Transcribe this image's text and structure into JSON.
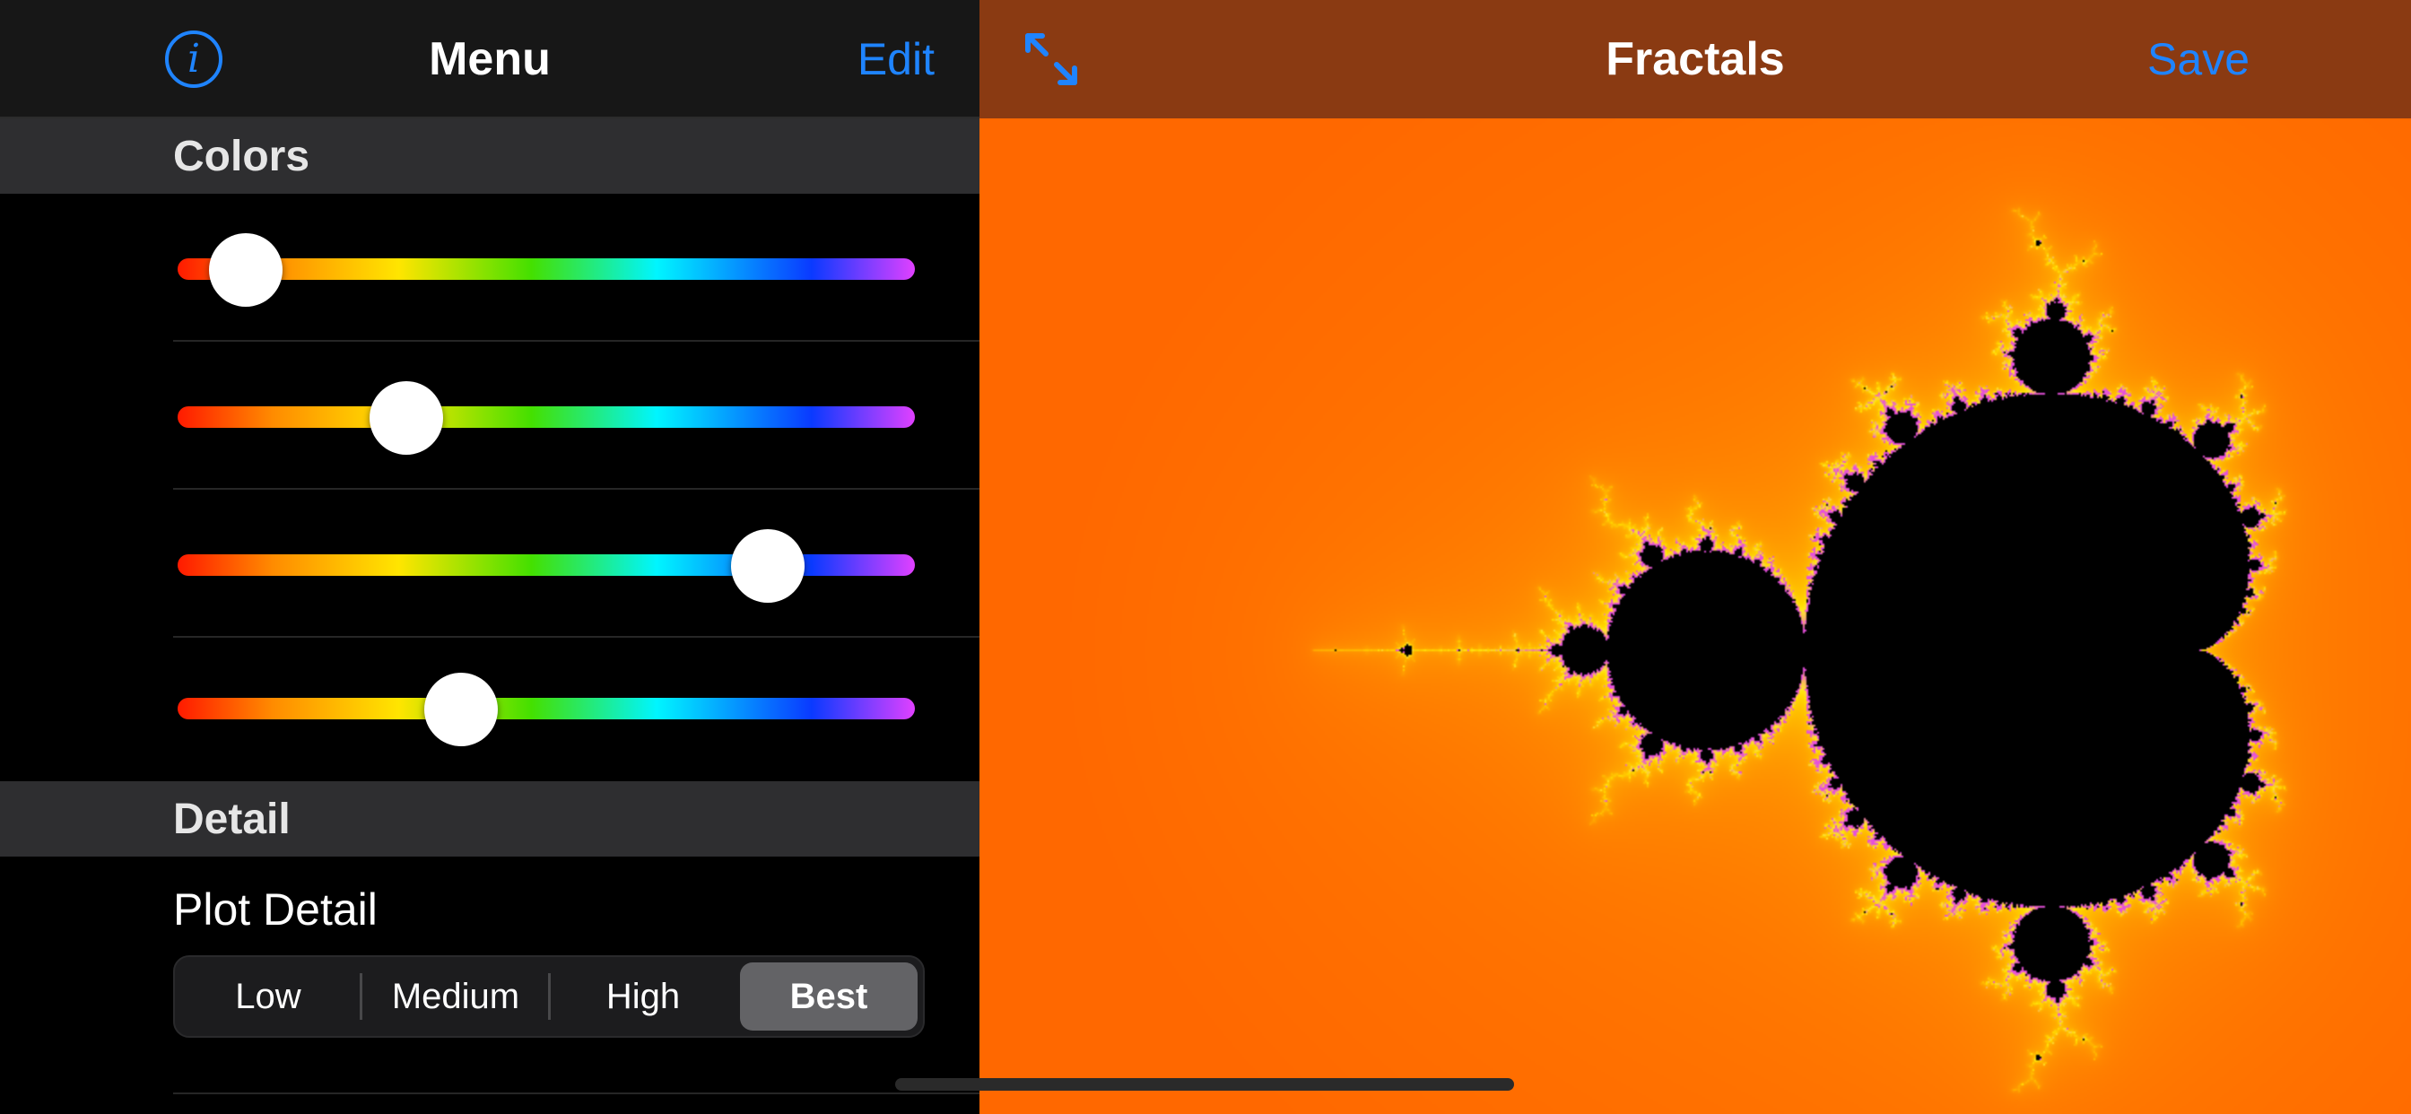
{
  "left_nav": {
    "info_glyph": "i",
    "title": "Menu",
    "edit_label": "Edit"
  },
  "sections": {
    "colors": "Colors",
    "detail": "Detail"
  },
  "color_sliders": [
    {
      "value": 0.093
    },
    {
      "value": 0.31
    },
    {
      "value": 0.8
    },
    {
      "value": 0.385
    }
  ],
  "plot_detail": {
    "label": "Plot Detail",
    "options": [
      "Low",
      "Medium",
      "High",
      "Best"
    ],
    "selected": "Best"
  },
  "right_nav": {
    "title": "Fractals",
    "save_label": "Save",
    "expand_icon": "expand-arrows-icon"
  },
  "colors": {
    "accent": "#1f84ff",
    "fractal_background": "#ff6a00",
    "fractal_edge": "#ffd21a",
    "fractal_fringe": "#e64ad6",
    "fractal_set": "#000000"
  }
}
